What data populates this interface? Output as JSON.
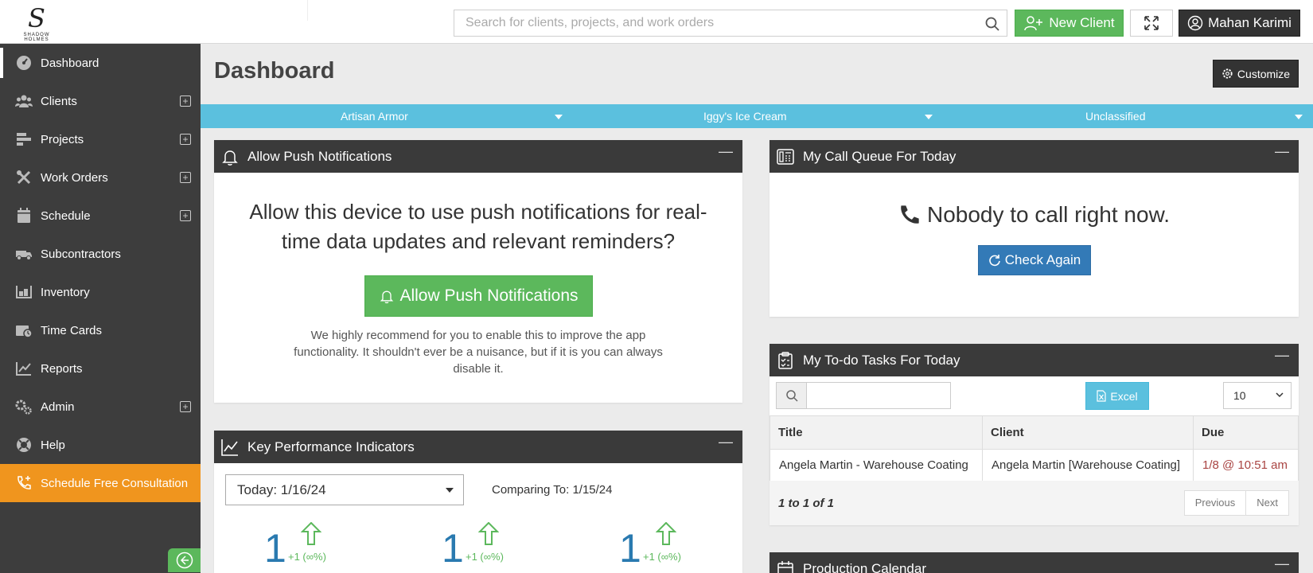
{
  "brand": {
    "logo_letter": "S",
    "logo_text": "SHADOW HOLMES"
  },
  "topbar": {
    "search_placeholder": "Search for clients, projects, and work orders",
    "new_client_label": "New Client",
    "user_label": "Mahan Karimi"
  },
  "sidebar": {
    "items": [
      {
        "label": "Dashboard",
        "icon": "gauge-icon",
        "has_add": false,
        "active": true
      },
      {
        "label": "Clients",
        "icon": "users-icon",
        "has_add": true
      },
      {
        "label": "Projects",
        "icon": "projects-icon",
        "has_add": true
      },
      {
        "label": "Work Orders",
        "icon": "tools-icon",
        "has_add": true
      },
      {
        "label": "Schedule",
        "icon": "calendar-icon",
        "has_add": true
      },
      {
        "label": "Subcontractors",
        "icon": "truck-icon",
        "has_add": false
      },
      {
        "label": "Inventory",
        "icon": "warehouse-icon",
        "has_add": false
      },
      {
        "label": "Time Cards",
        "icon": "timecard-icon",
        "has_add": false
      },
      {
        "label": "Reports",
        "icon": "chart-icon",
        "has_add": false
      },
      {
        "label": "Admin",
        "icon": "gears-icon",
        "has_add": true
      },
      {
        "label": "Help",
        "icon": "lifebuoy-icon",
        "has_add": false
      },
      {
        "label": "Schedule Free Consultation",
        "icon": "phone-plus-icon",
        "has_add": false
      }
    ],
    "add_symbol": "+"
  },
  "main": {
    "title": "Dashboard",
    "customize_label": "Customize",
    "filters": [
      "Artisan Armor",
      "Iggy's Ice Cream",
      "Unclassified"
    ]
  },
  "push_panel": {
    "title": "Allow Push Notifications",
    "minimize_symbol": "—",
    "message": "Allow this device to use push notifications for real-time data updates and relevant reminders?",
    "button_label": "Allow Push Notifications",
    "note": "We highly recommend for you to enable this to improve the app functionality. It shouldn't ever be a nuisance, but if it is you can always disable it."
  },
  "call_panel": {
    "title": "My Call Queue For Today",
    "message": "Nobody to call right now.",
    "button_label": "Check Again"
  },
  "todo_panel": {
    "title": "My To-do Tasks For Today",
    "excel_label": "Excel",
    "page_size": "10",
    "columns": [
      "Title",
      "Client",
      "Due"
    ],
    "rows": [
      {
        "title": "Angela Martin - Warehouse Coating",
        "client": "Angela Martin [Warehouse Coating]",
        "due": "1/8 @ 10:51 am"
      }
    ],
    "count_text": "1 to 1 of 1",
    "prev_label": "Previous",
    "next_label": "Next"
  },
  "kpi_panel": {
    "title": "Key Performance Indicators",
    "date_select": "Today: 1/16/24",
    "compare_text": "Comparing To: 1/15/24",
    "metrics": [
      {
        "value": "1",
        "delta": "+1 (∞%)"
      },
      {
        "value": "1",
        "delta": "+1 (∞%)"
      },
      {
        "value": "1",
        "delta": "+1 (∞%)"
      }
    ]
  },
  "calendar_panel": {
    "title": "Production Calendar"
  },
  "colors": {
    "green": "#5cb85c",
    "orange": "#f0951e",
    "sidebar": "#3d3d3d",
    "filterbar": "#5bc0de",
    "blue": "#337ab7"
  }
}
